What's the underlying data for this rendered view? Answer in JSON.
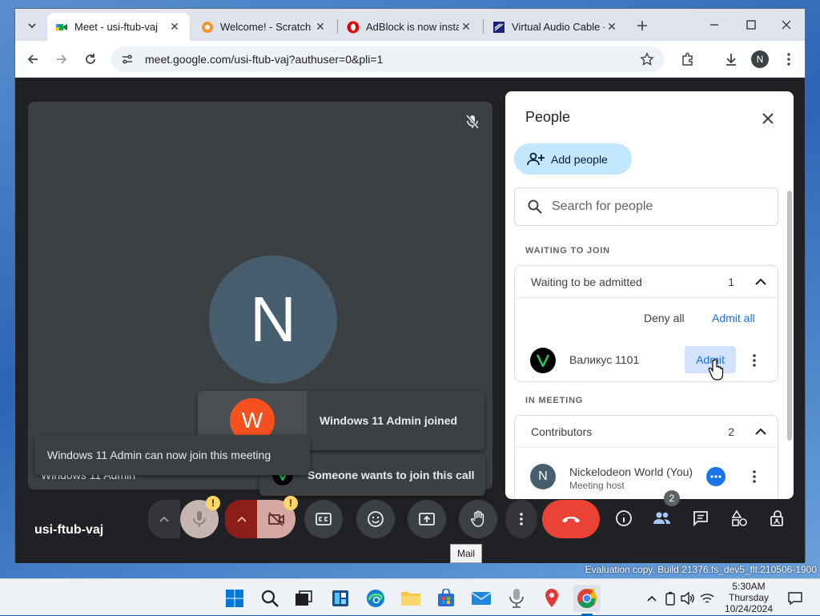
{
  "browser": {
    "tabs": [
      {
        "title": "Meet - usi-ftub-vaj",
        "close": "✕"
      },
      {
        "title": "Welcome! - Scratch Ad",
        "close": "✕"
      },
      {
        "title": "AdBlock is now install",
        "close": "✕"
      },
      {
        "title": "Virtual Audio Cable - ",
        "close": "✕"
      }
    ],
    "url": "meet.google.com/usi-ftub-vaj?authuser=0&pli=1",
    "profile_initial": "N"
  },
  "meeting": {
    "code": "usi-ftub-vaj",
    "tile": {
      "avatar_initial": "N",
      "name": "Windows 11 Admin"
    },
    "toasts": {
      "joined": {
        "initial": "W",
        "text": "Windows 11 Admin joined"
      },
      "can_join": "Windows 11 Admin can now join this meeting",
      "wants": "Someone wants to join this call"
    },
    "participants_badge": "2",
    "tooltip": "Mail"
  },
  "people_panel": {
    "title": "People",
    "add_people": "Add people",
    "search_placeholder": "Search for people",
    "waiting_section": "WAITING TO JOIN",
    "waiting_group": {
      "label": "Waiting to be admitted",
      "count": "1"
    },
    "deny_all": "Deny all",
    "admit_all": "Admit all",
    "waiting_person": {
      "name": "Валикус 1101",
      "admit": "Admit"
    },
    "in_meeting_section": "IN MEETING",
    "contributors": {
      "label": "Contributors",
      "count": "2"
    },
    "member": {
      "initial": "N",
      "name": "Nickelodeon World (You)",
      "role": "Meeting host"
    }
  },
  "desktop": {
    "watermark": "Evaluation copy. Build 21376.fs_dev5_flt.210506-1900",
    "clock": {
      "time": "5:30AM",
      "day": "Thursday",
      "date": "10/24/2024"
    }
  },
  "colors": {
    "end_call": "#ea4335",
    "primary_blue": "#1a73e8",
    "admit_bg": "#d3e3fd"
  }
}
